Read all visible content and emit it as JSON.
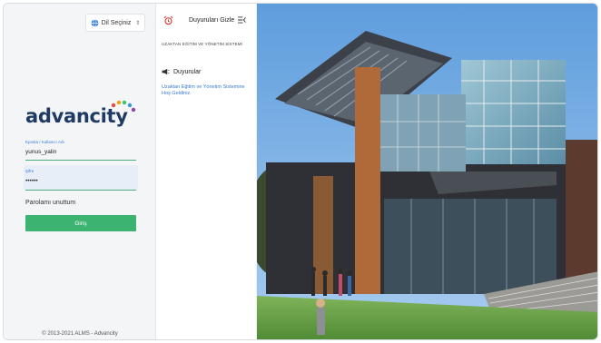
{
  "language_selector": {
    "label": "Dil Seçiniz"
  },
  "brand": {
    "logo_text": "advancity"
  },
  "login": {
    "username_label": "Eposta / Kullanıcı Adı",
    "username_value": "yunus_yalin",
    "password_label": "Şifre",
    "password_value": "••••••",
    "forgot_label": "Parolamı unuttum",
    "submit_label": "Giriş"
  },
  "footer": {
    "copyright": "© 2013-2021 ALMS - Advancity"
  },
  "announcements": {
    "hide_label": "Duyuruları Gizle",
    "system_name": "UZAKTAN EĞİTİM VE YÖNETİM SİSTEMİ",
    "section_title": "Duyurular",
    "items": [
      {
        "text": "Uzaktan Eğitim ve Yönetim Sistemine Hoş Geldiniz."
      }
    ]
  },
  "colors": {
    "brand_navy": "#1f3b63",
    "accent_green": "#3cb371",
    "link_blue": "#3a7bd5",
    "alarm_red": "#d9342b"
  },
  "icons": [
    "globe-icon",
    "chevron-updown-icon",
    "alarm-clock-icon",
    "hide-panel-icon",
    "megaphone-icon"
  ]
}
